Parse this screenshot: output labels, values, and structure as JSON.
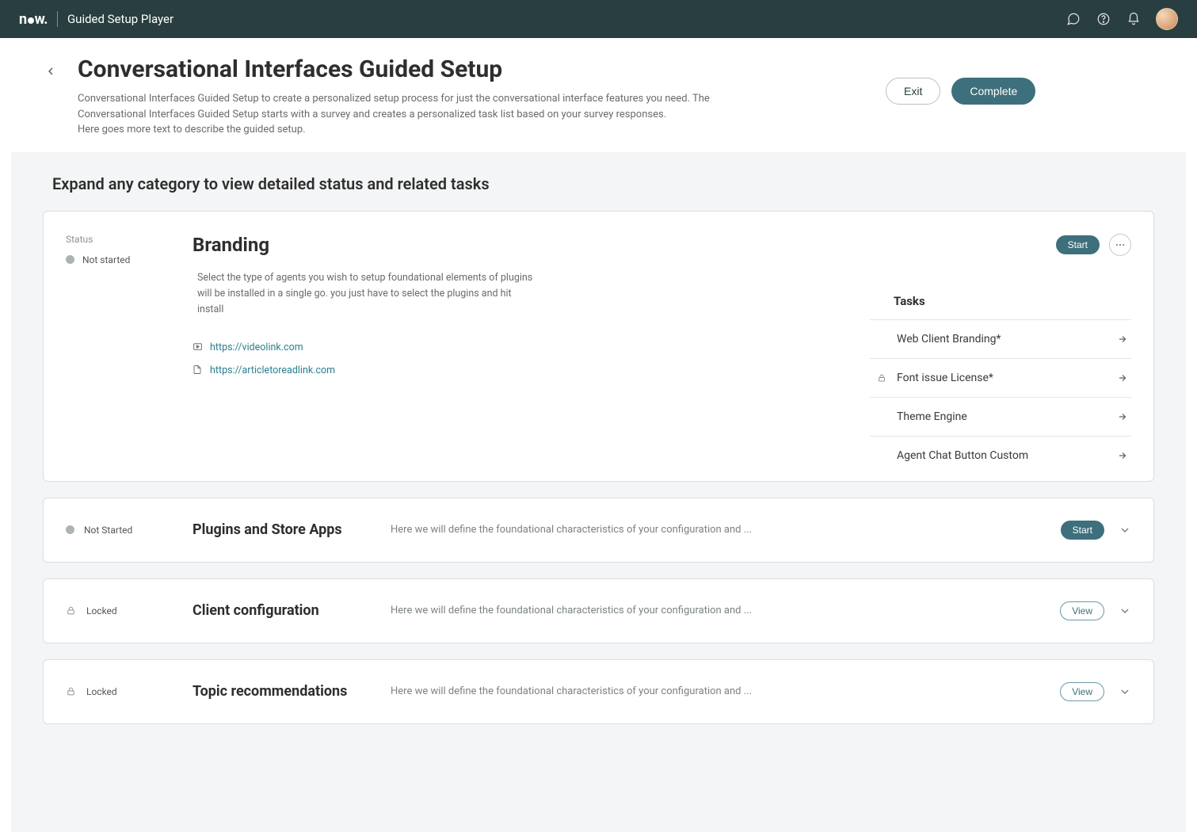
{
  "topbar": {
    "brand": "now.",
    "title": "Guided Setup Player"
  },
  "header": {
    "title": "Conversational Interfaces Guided Setup",
    "description": "Conversational Interfaces Guided Setup to create a personalized setup process for just the conversational interface features you need. The Conversational Interfaces Guided Setup starts with a survey and creates a personalized task list based on your survey responses.\nHere goes more text to describe the guided setup.",
    "exit_label": "Exit",
    "complete_label": "Complete"
  },
  "body": {
    "heading": "Expand any category to view detailed status and related tasks"
  },
  "expanded_category": {
    "status_label": "Status",
    "status_text": "Not started",
    "title": "Branding",
    "description": "Select the type of agents you wish to setup foundational elements of plugins will be installed in a single go. you just have to select the plugins and hit install",
    "video_link": "https://videolink.com",
    "article_link": "https://articletoreadlink.com",
    "start_label": "Start",
    "tasks_heading": "Tasks",
    "tasks": [
      {
        "label": "Web Client Branding*",
        "locked": false
      },
      {
        "label": "Font issue License*",
        "locked": true
      },
      {
        "label": "Theme Engine",
        "locked": false
      },
      {
        "label": "Agent Chat Button Custom",
        "locked": false
      }
    ]
  },
  "collapsed_categories": [
    {
      "status_text": "Not Started",
      "status_kind": "dot",
      "title": "Plugins and Store Apps",
      "description": "Here we will define the foundational characteristics of your configuration and  ...",
      "action": "start"
    },
    {
      "status_text": "Locked",
      "status_kind": "lock",
      "title": "Client configuration",
      "description": "Here we will define the foundational characteristics of your configuration and  ...",
      "action": "view"
    },
    {
      "status_text": "Locked",
      "status_kind": "lock",
      "title": "Topic recommendations",
      "description": "Here we will define the foundational characteristics of your configuration and  ...",
      "action": "view"
    }
  ],
  "labels": {
    "start": "Start",
    "view": "View"
  }
}
